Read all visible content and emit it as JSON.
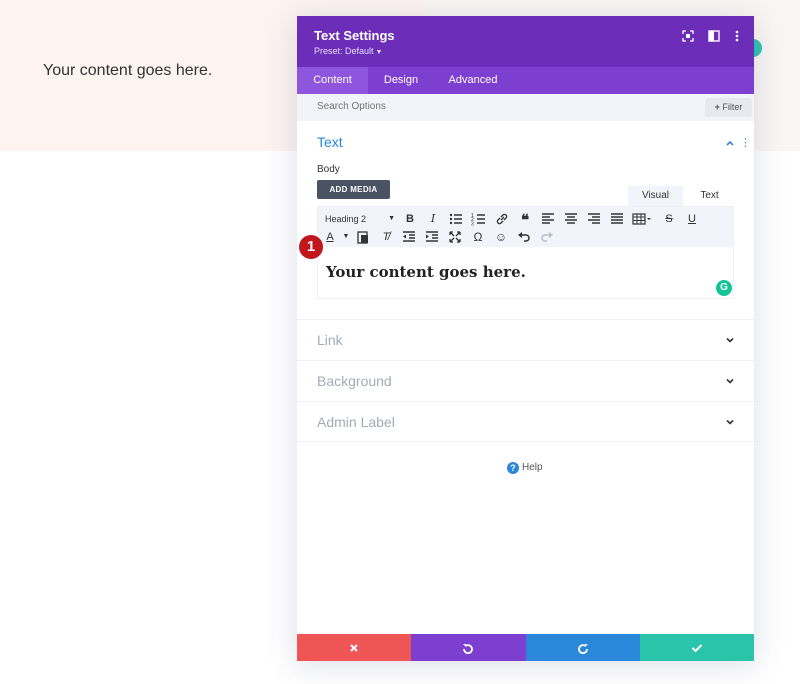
{
  "page": {
    "content_text": "Your content goes here."
  },
  "modal": {
    "title": "Text Settings",
    "preset": "Preset: Default",
    "header_icons": [
      "focus-icon",
      "split-view-icon",
      "more-vert-icon"
    ],
    "tabs": [
      {
        "label": "Content",
        "active": true
      },
      {
        "label": "Design",
        "active": false
      },
      {
        "label": "Advanced",
        "active": false
      }
    ],
    "search": {
      "placeholder": "Search Options",
      "filter_label": "Filter"
    },
    "text_section": {
      "title": "Text",
      "body_label": "Body",
      "add_media_label": "ADD MEDIA",
      "editor_tabs": {
        "visual": "Visual",
        "text": "Text"
      },
      "heading_select": "Heading 2",
      "content": "Your content goes here.",
      "grammarly": "G"
    },
    "badge": "1",
    "sections": [
      {
        "label": "Link"
      },
      {
        "label": "Background"
      },
      {
        "label": "Admin Label"
      }
    ],
    "help_label": "Help",
    "colors": {
      "header": "#6c2eb9",
      "tabs": "#7d3fd0",
      "accent_blue": "#2b87da",
      "footer_cancel": "#ef5555",
      "footer_undo": "#7d3fd0",
      "footer_redo": "#2b87da",
      "footer_save": "#29c4a9"
    }
  }
}
